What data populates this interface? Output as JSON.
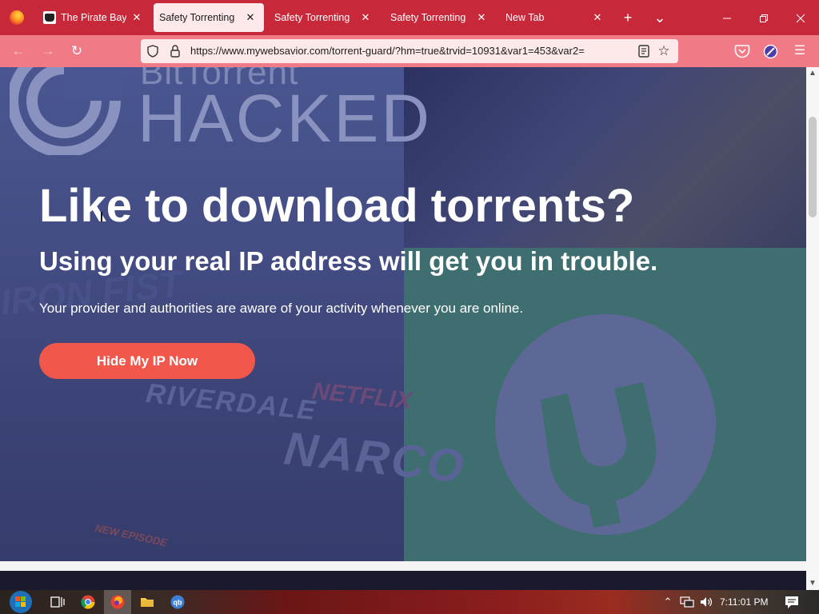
{
  "browser": {
    "tabs": [
      {
        "label": "The Pirate Bay - ",
        "active": false
      },
      {
        "label": "Safety Torrenting",
        "active": true
      },
      {
        "label": "Safety Torrenting",
        "active": false
      },
      {
        "label": "Safety Torrenting",
        "active": false
      },
      {
        "label": "New Tab",
        "active": false
      }
    ],
    "close_glyph": "✕",
    "new_tab_glyph": "+",
    "list_tabs_glyph": "⌄",
    "url": "https://www.mywebsavior.com/torrent-guard/?hm=true&trvid=10931&var1=453&var2=",
    "accent_color": "#c8293a",
    "toolbar_color": "#f07b86"
  },
  "page": {
    "background_logo_text": "BitTorrent",
    "background_hacked_text": "HACKED",
    "poster_texts": [
      "RIVERDALE",
      "NETFLIX",
      "NARCO",
      "IRON FIST",
      "NEW EPISODE"
    ],
    "headline": "Like to download torrents?",
    "subheadline": "Using your real IP address will get you in trouble.",
    "body": "Your provider and authorities are aware of your activity whenever you are online.",
    "cta_label": "Hide My IP Now",
    "cta_color": "#f2574c"
  },
  "taskbar": {
    "apps": [
      "task-view",
      "chrome",
      "firefox",
      "file-explorer",
      "qbittorrent"
    ],
    "active_app": "firefox",
    "clock": "7:11:01 PM"
  }
}
